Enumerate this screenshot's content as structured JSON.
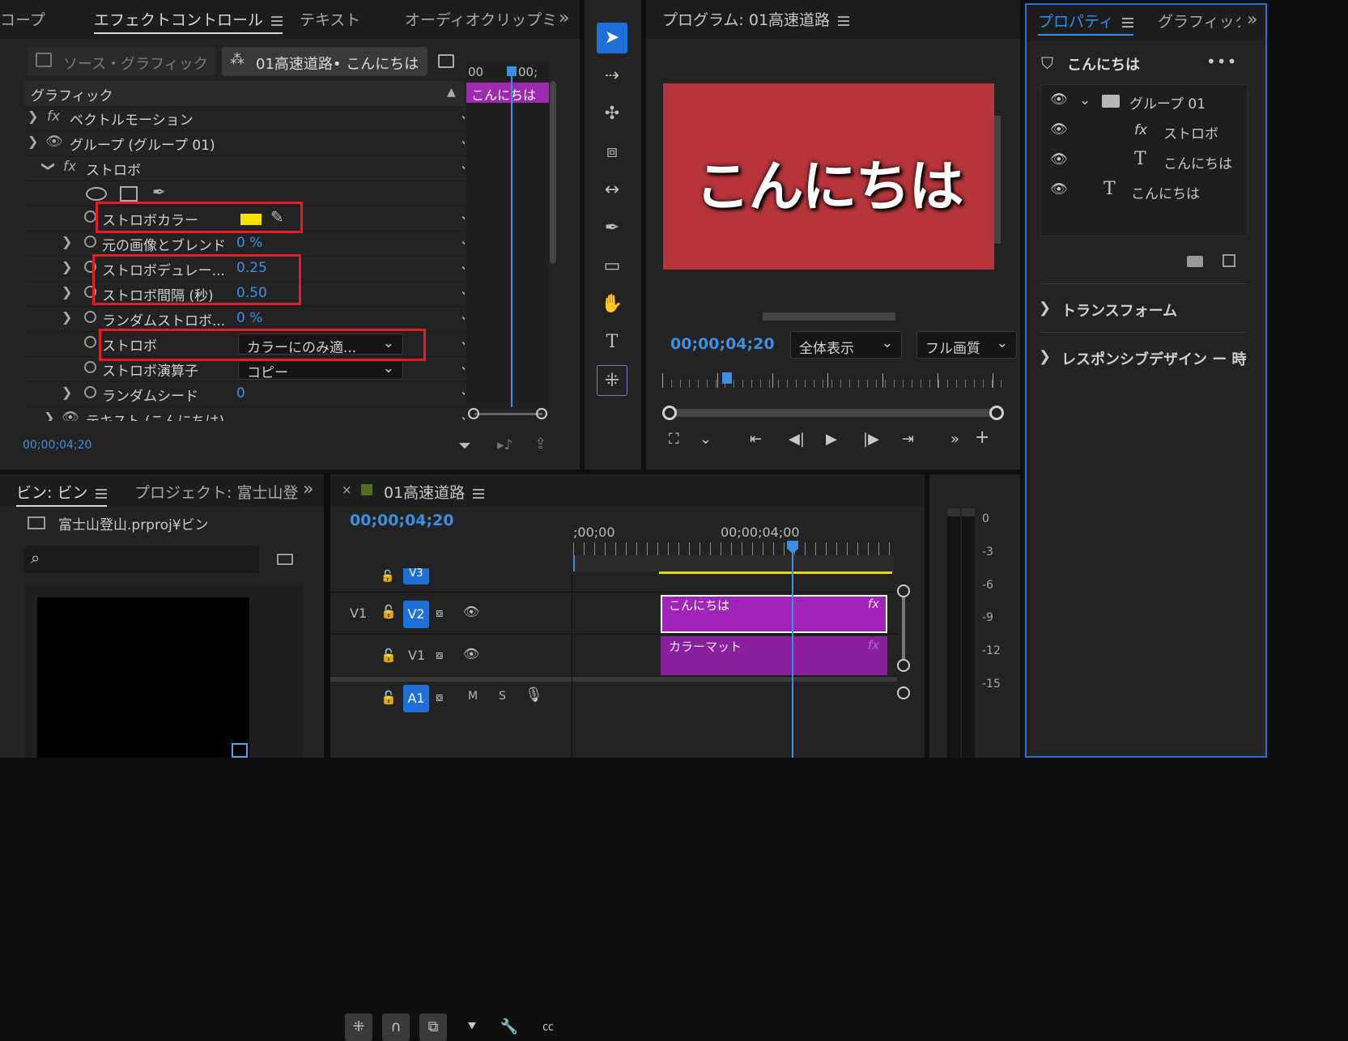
{
  "effect_controls": {
    "tabs": [
      "コープ",
      "エフェクトコントロール",
      "テキスト",
      "オーディオクリップミ"
    ],
    "source_button": "ソース・グラフィック",
    "clip_button": "01高速道路• こんにちは",
    "timecode_ruler": [
      "00",
      "00;"
    ],
    "clip_bar": "こんにちは",
    "section": "グラフィック",
    "rows": {
      "vector_motion": "ベクトルモーション",
      "group": "グループ (グループ 01)",
      "strobe": "ストロボ",
      "strobe_color": "ストロボカラー",
      "blend": "元の画像とブレンド",
      "blend_val": "0 %",
      "duration": "ストロボデュレー...",
      "duration_val": "0.25",
      "interval": "ストロボ間隔 (秒)",
      "interval_val": "0.50",
      "random": "ランダムストロボ...",
      "random_val": "0 %",
      "strobe2": "ストロボ",
      "strobe2_val": "カラーにのみ適...",
      "operator": "ストロボ演算子",
      "operator_val": "コピー",
      "seed": "ランダムシード",
      "seed_val": "0",
      "text_layer": "テキスト (こんにちは)"
    },
    "timecode": "00;00;04;20",
    "strobe_color_hex": "#f5e000"
  },
  "program": {
    "title": "プログラム: 01高速道路",
    "preview_text": "こんにちは",
    "preview_bg": "#b5353a",
    "timecode": "00;00;04;20",
    "zoom": "全体表示",
    "quality": "フル画質"
  },
  "properties": {
    "tabs": [
      "プロパティ",
      "グラフィック"
    ],
    "item_title": "こんにちは",
    "layers": [
      {
        "name": "グループ 01",
        "icon": "folder-icon"
      },
      {
        "name": "ストロボ",
        "icon": "fx-icon"
      },
      {
        "name": "こんにちは",
        "icon": "text-icon"
      },
      {
        "name": "こんにちは",
        "icon": "text-icon"
      }
    ],
    "transform": "トランスフォーム",
    "responsive": "レスポンシブデザイン ー 時"
  },
  "bin": {
    "tabs": [
      "ビン: ビン",
      "プロジェクト: 富士山登山"
    ],
    "path": "富士山登山.prproj¥ビン",
    "search_placeholder": ""
  },
  "timeline": {
    "close": "×",
    "title": "01高速道路",
    "timecode": "00;00;04;20",
    "ruler": [
      ";00;00",
      "00;00;04;00"
    ],
    "tracks": {
      "v3": "V3",
      "v2_src": "V1",
      "v2": "V2",
      "v1": "V1",
      "a1": "A1",
      "m": "M",
      "s": "S"
    },
    "clips": {
      "v2": "こんにちは",
      "v1": "カラーマット",
      "fx": "fx"
    }
  },
  "audio_meter": {
    "labels": [
      "0",
      "-3",
      "-6",
      "-9",
      "-12",
      "-15"
    ]
  }
}
